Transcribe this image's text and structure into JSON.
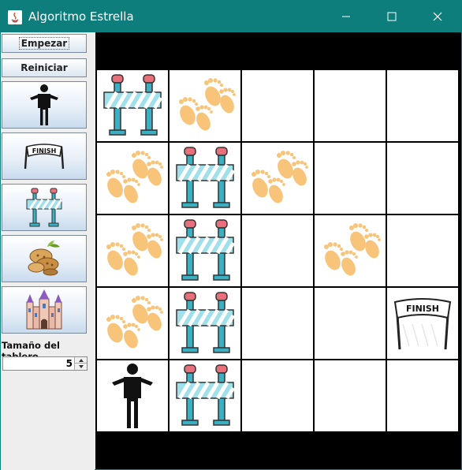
{
  "window": {
    "title": "Algoritmo Estrella",
    "colors": {
      "titlebar": "#0e7e7d",
      "board_background": "#000000",
      "cell": "#ffffff"
    }
  },
  "sidebar": {
    "start_label": "Empezar",
    "reset_label": "Reiniciar",
    "tool_buttons": [
      {
        "icon": "person-icon"
      },
      {
        "icon": "finish-flag-icon"
      },
      {
        "icon": "barrier-icon"
      },
      {
        "icon": "peanuts-icon"
      },
      {
        "icon": "castle-icon"
      }
    ],
    "board_size_label": "Tamaño del tablero",
    "board_size_value": "5"
  },
  "board": {
    "rows": 5,
    "cols": 5,
    "cells": [
      [
        "barrier",
        "footprints",
        "empty",
        "empty",
        "empty"
      ],
      [
        "footprints",
        "barrier",
        "footprints",
        "empty",
        "empty"
      ],
      [
        "footprints",
        "barrier",
        "empty",
        "footprints",
        "empty"
      ],
      [
        "footprints",
        "barrier",
        "empty",
        "empty",
        "finish"
      ],
      [
        "person",
        "barrier",
        "empty",
        "empty",
        "empty"
      ]
    ],
    "finish_text": "FINISH"
  }
}
